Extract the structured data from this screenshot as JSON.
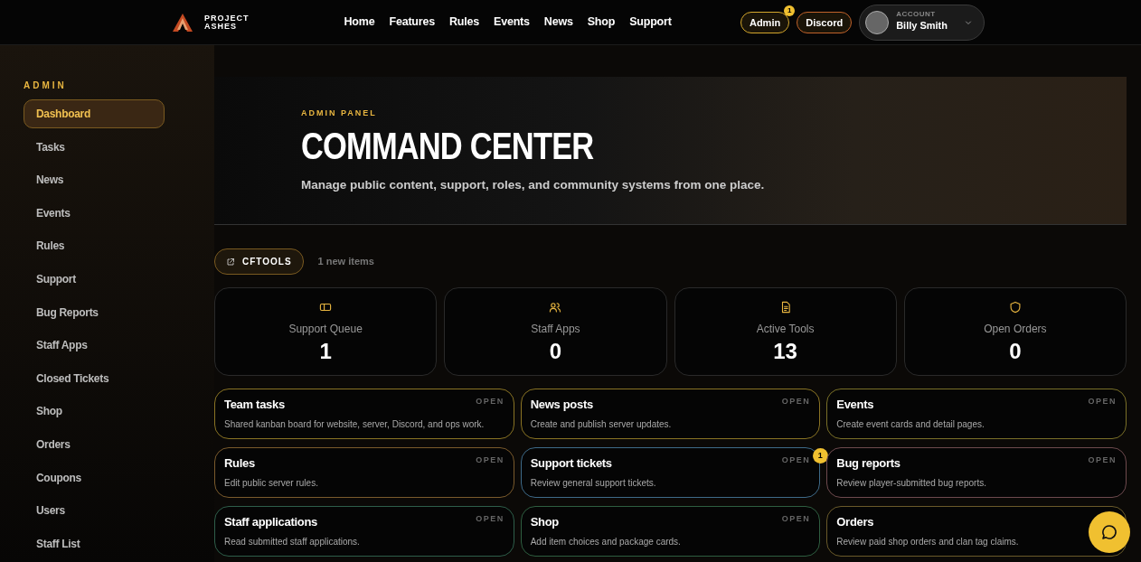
{
  "brand": {
    "line_1": "PROJECT",
    "line_2": "ASHES"
  },
  "nav": [
    "Home",
    "Features",
    "Rules",
    "Events",
    "News",
    "Shop",
    "Support"
  ],
  "header_buttons": [
    {
      "label": "Admin",
      "badge": "1",
      "color": "#d4a72c"
    },
    {
      "label": "Discord",
      "color": "#c0622a"
    }
  ],
  "account": {
    "caption": "ACCOUNT",
    "name": "Billy Smith"
  },
  "sidebar": {
    "heading": "ADMIN",
    "items": [
      {
        "label": "Dashboard",
        "selected": true
      },
      {
        "label": "Tasks",
        "selected": false
      },
      {
        "label": "News",
        "selected": false
      },
      {
        "label": "Events",
        "selected": false
      },
      {
        "label": "Rules",
        "selected": false
      },
      {
        "label": "Support",
        "selected": false
      },
      {
        "label": "Bug Reports",
        "selected": false
      },
      {
        "label": "Staff Apps",
        "selected": false
      },
      {
        "label": "Closed Tickets",
        "selected": false
      },
      {
        "label": "Shop",
        "selected": false
      },
      {
        "label": "Orders",
        "selected": false
      },
      {
        "label": "Coupons",
        "selected": false
      },
      {
        "label": "Users",
        "selected": false
      },
      {
        "label": "Staff List",
        "selected": false
      }
    ]
  },
  "hero": {
    "eyebrow": "ADMIN PANEL",
    "title": "COMMAND CENTER",
    "subtitle": "Manage public content, support, roles, and community systems from one place."
  },
  "cftools": {
    "label": "CFTOOLS",
    "note": "1 new items"
  },
  "stats": [
    {
      "kind": "ticket",
      "label": "Support Queue",
      "value": "1"
    },
    {
      "kind": "people",
      "label": "Staff Apps",
      "value": "0"
    },
    {
      "kind": "document",
      "label": "Active Tools",
      "value": "13"
    },
    {
      "kind": "shield",
      "label": "Open Orders",
      "value": "0"
    }
  ],
  "tools": [
    {
      "title": "Team tasks",
      "status": "OPEN",
      "description": "Shared kanban board for website, server, Discord, and ops work.",
      "color": "#8a7424"
    },
    {
      "title": "News posts",
      "status": "OPEN",
      "description": "Create and publish server updates.",
      "color": "#8a7424"
    },
    {
      "title": "Events",
      "status": "OPEN",
      "description": "Create event cards and detail pages.",
      "color": "#7a7028"
    },
    {
      "title": "Rules",
      "status": "OPEN",
      "description": "Edit public server rules.",
      "color": "#7a5a2c"
    },
    {
      "title": "Support tickets",
      "status": "OPEN",
      "description": "Review general support tickets.",
      "color": "#3e6a88",
      "badge": "1"
    },
    {
      "title": "Bug reports",
      "status": "OPEN",
      "description": "Review player-submitted bug reports.",
      "color": "#6e4a4e"
    },
    {
      "title": "Staff applications",
      "status": "OPEN",
      "description": "Read submitted staff applications.",
      "color": "#2e5e4a"
    },
    {
      "title": "Shop",
      "status": "OPEN",
      "description": "Add item choices and package cards.",
      "color": "#2e5e40"
    },
    {
      "title": "Orders",
      "description": "Review paid shop orders and clan tag claims.",
      "color": "#6a5a2a"
    }
  ]
}
